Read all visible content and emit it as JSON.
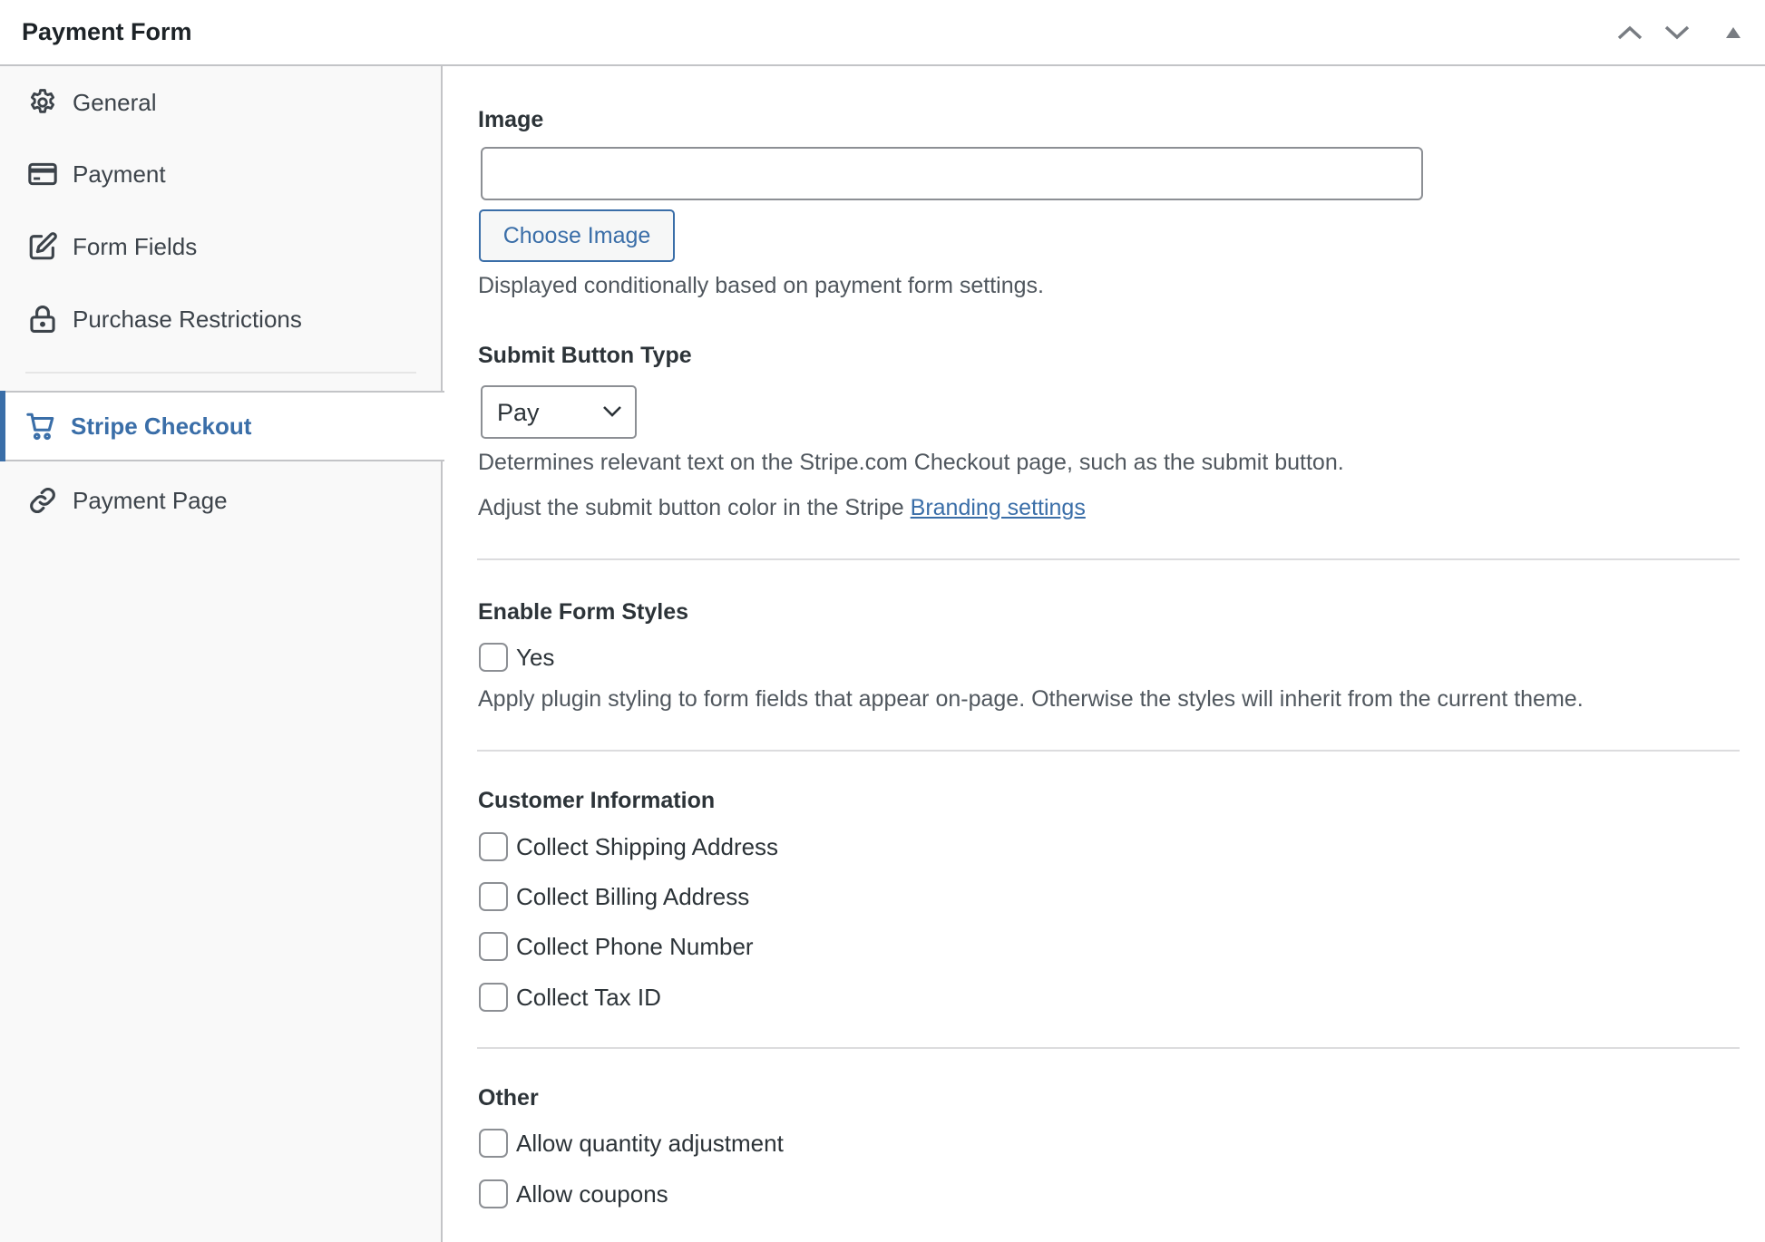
{
  "header": {
    "title": "Payment Form",
    "controls": [
      {
        "name": "move-up-button",
        "icon": "chevron-up-icon"
      },
      {
        "name": "move-down-button",
        "icon": "chevron-down-icon"
      },
      {
        "name": "toggle-panel-button",
        "icon": "triangle-up-icon"
      }
    ]
  },
  "sidebar": {
    "items": [
      {
        "label": "General",
        "icon": "gear-icon",
        "active": false
      },
      {
        "label": "Payment",
        "icon": "credit-card-icon",
        "active": false
      },
      {
        "label": "Form Fields",
        "icon": "edit-icon",
        "active": false
      },
      {
        "label": "Purchase Restrictions",
        "icon": "lock-icon",
        "active": false
      },
      {
        "label": "Stripe Checkout",
        "icon": "cart-icon",
        "active": true
      },
      {
        "label": "Payment Page",
        "icon": "link-icon",
        "active": false
      }
    ]
  },
  "colors": {
    "accent": "#3a6ea8",
    "text": "#2c3338",
    "muted": "#50575e",
    "border": "#c3c4c7"
  },
  "main": {
    "image": {
      "label": "Image",
      "value": "",
      "placeholder": "",
      "button_label": "Choose Image",
      "help": "Displayed conditionally based on payment form settings."
    },
    "submit_button_type": {
      "label": "Submit Button Type",
      "selected": "Pay",
      "help": "Determines relevant text on the Stripe.com Checkout page, such as the submit button.",
      "adjust_prefix": "Adjust the submit button color in the Stripe ",
      "adjust_link": "Branding settings"
    },
    "form_styles": {
      "label": "Enable Form Styles",
      "checkbox_label": "Yes",
      "checked": false,
      "help": "Apply plugin styling to form fields that appear on-page. Otherwise the styles will inherit from the current theme."
    },
    "customer_information": {
      "label": "Customer Information",
      "options": [
        {
          "label": "Collect Shipping Address",
          "checked": false
        },
        {
          "label": "Collect Billing Address",
          "checked": false
        },
        {
          "label": "Collect Phone Number",
          "checked": false
        },
        {
          "label": "Collect Tax ID",
          "checked": false
        }
      ]
    },
    "other": {
      "label": "Other",
      "options": [
        {
          "label": "Allow quantity adjustment",
          "checked": false
        },
        {
          "label": "Allow coupons",
          "checked": false
        }
      ]
    }
  }
}
